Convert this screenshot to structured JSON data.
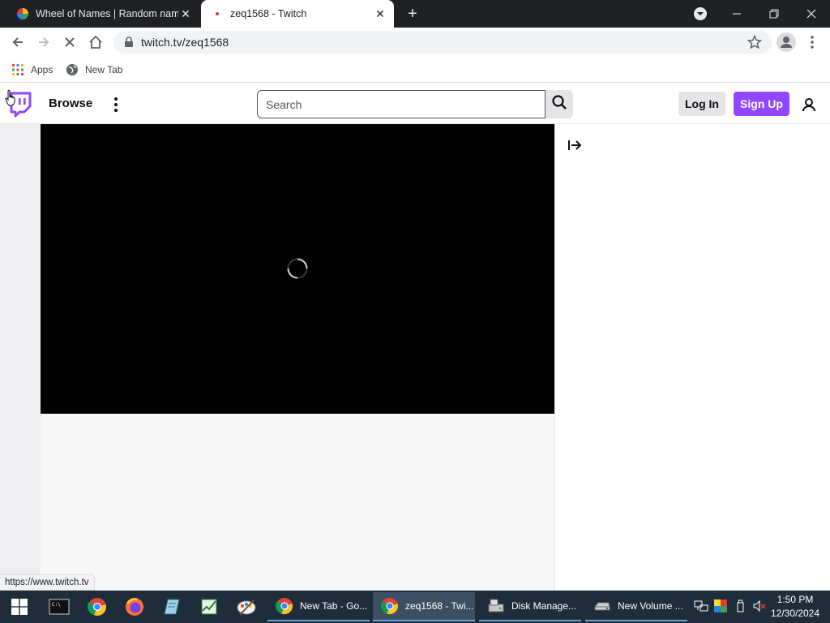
{
  "browser": {
    "tabs": [
      {
        "title": "Wheel of Names | Random name picker",
        "active": false
      },
      {
        "title": "zeq1568 - Twitch",
        "active": true
      }
    ],
    "new_tab_symbol": "+",
    "address": "twitch.tv/zeq1568",
    "bookmarks": [
      {
        "label": "Apps",
        "icon": "apps-grid-icon"
      },
      {
        "label": "New Tab",
        "icon": "globe-icon"
      }
    ],
    "status_url": "https://www.twitch.tv"
  },
  "twitch": {
    "browse_label": "Browse",
    "search_placeholder": "Search",
    "login_label": "Log In",
    "signup_label": "Sign Up",
    "brand_color": "#9147ff"
  },
  "taskbar": {
    "tasks": [
      {
        "label": "New Tab - Go...",
        "icon": "chrome-icon"
      },
      {
        "label": "zeq1568 - Twi...",
        "icon": "chrome-icon"
      },
      {
        "label": "Disk Manage...",
        "icon": "disk-management-icon"
      },
      {
        "label": "New Volume ...",
        "icon": "drive-icon"
      }
    ],
    "time": "1:50 PM",
    "date": "12/30/2024"
  }
}
